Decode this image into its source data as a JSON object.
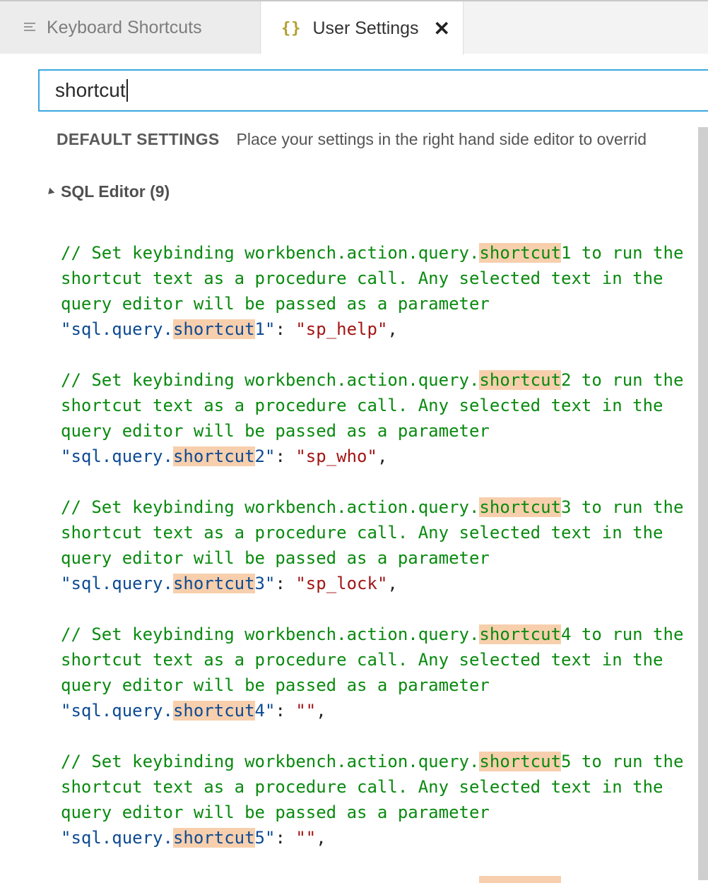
{
  "tabs": [
    {
      "label": "Keyboard Shortcuts",
      "icon": "list-icon",
      "active": false
    },
    {
      "label": "User Settings",
      "icon": "braces-icon",
      "icon_glyph": "{}",
      "active": true,
      "close": "✕"
    }
  ],
  "search": {
    "value": "shortcut"
  },
  "default_settings": {
    "label": "DEFAULT SETTINGS",
    "description": "Place your settings in the right hand side editor to overrid"
  },
  "group": {
    "title": "SQL Editor (9)"
  },
  "highlight_term": "shortcut",
  "entries": [
    {
      "comment_1a": "// Set keybinding workbench.action.query.",
      "comment_1b": "1 to run the",
      "comment_2": "shortcut text as a procedure call. Any selected text in the",
      "comment_3": "query editor will be passed as a parameter",
      "key_a": "\"sql.query.",
      "key_b": "1\"",
      "value": "\"sp_help\""
    },
    {
      "comment_1a": "// Set keybinding workbench.action.query.",
      "comment_1b": "2 to run the",
      "comment_2": "shortcut text as a procedure call. Any selected text in the",
      "comment_3": "query editor will be passed as a parameter",
      "key_a": "\"sql.query.",
      "key_b": "2\"",
      "value": "\"sp_who\""
    },
    {
      "comment_1a": "// Set keybinding workbench.action.query.",
      "comment_1b": "3 to run the",
      "comment_2": "shortcut text as a procedure call. Any selected text in the",
      "comment_3": "query editor will be passed as a parameter",
      "key_a": "\"sql.query.",
      "key_b": "3\"",
      "value": "\"sp_lock\""
    },
    {
      "comment_1a": "// Set keybinding workbench.action.query.",
      "comment_1b": "4 to run the",
      "comment_2": "shortcut text as a procedure call. Any selected text in the",
      "comment_3": "query editor will be passed as a parameter",
      "key_a": "\"sql.query.",
      "key_b": "4\"",
      "value": "\"\""
    },
    {
      "comment_1a": "// Set keybinding workbench.action.query.",
      "comment_1b": "5 to run the",
      "comment_2": "shortcut text as a procedure call. Any selected text in the",
      "comment_3": "query editor will be passed as a parameter",
      "key_a": "\"sql.query.",
      "key_b": "5\"",
      "value": "\"\""
    }
  ],
  "colors": {
    "comment": "#098a0f",
    "key": "#0c4a94",
    "string": "#a31515",
    "highlight": "#f7cfad",
    "focus": "#3ba7e0"
  }
}
